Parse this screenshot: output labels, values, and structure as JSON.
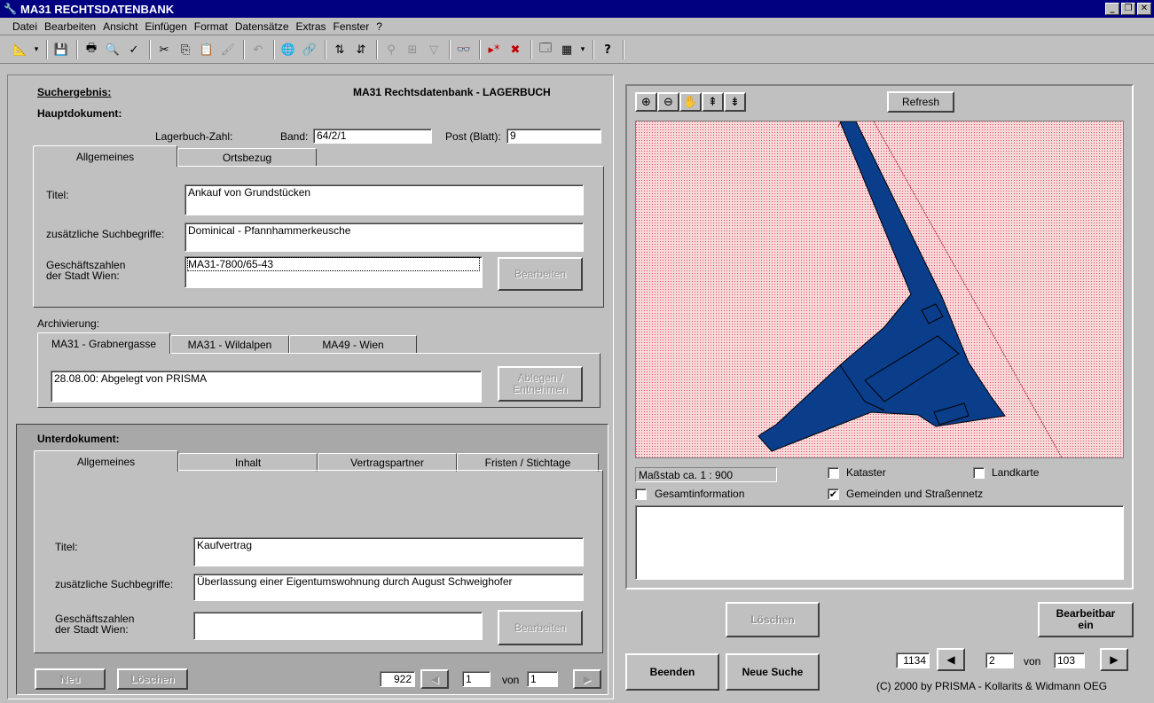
{
  "window": {
    "title": "MA31 RECHTSDATENBANK"
  },
  "menu": [
    "Datei",
    "Bearbeiten",
    "Ansicht",
    "Einfügen",
    "Format",
    "Datensätze",
    "Extras",
    "Fenster",
    "?"
  ],
  "main": {
    "suchergebnis_label": "Suchergebnis:",
    "heading": "MA31 Rechtsdatenbank - LAGERBUCH",
    "hauptdokument_label": "Hauptdokument:",
    "lagerbuch_label": "Lagerbuch-Zahl:",
    "band_label": "Band:",
    "band_value": "64/2/1",
    "post_label": "Post (Blatt):",
    "post_value": "9",
    "tabs": [
      "Allgemeines",
      "Ortsbezug"
    ],
    "titel_label": "Titel:",
    "titel_value": "Ankauf von Grundstücken",
    "suchbegriffe_label": "zusätzliche Suchbegriffe:",
    "suchbegriffe_value": "Dominical - Pfannhammerkeusche",
    "geschaeftszahlen_label_1": "Geschäftszahlen",
    "geschaeftszahlen_label_2": "der Stadt Wien:",
    "geschaeftszahlen_value": "MA31-7800/65-43",
    "bearbeiten_label": "Bearbeiten",
    "archivierung_label": "Archivierung:",
    "archiv_tabs": [
      "MA31 - Grabnergasse",
      "MA31 - Wildalpen",
      "MA49 - Wien"
    ],
    "archiv_value": "28.08.00: Abgelegt von  PRISMA",
    "ablegen_label_1": "Ablegen /",
    "ablegen_label_2": "Entnehmen"
  },
  "sub": {
    "heading": "Unterdokument:",
    "tabs": [
      "Allgemeines",
      "Inhalt",
      "Vertragspartner",
      "Fristen / Stichtage"
    ],
    "titel_label": "Titel:",
    "titel_value": "Kaufvertrag",
    "suchbegriffe_label": "zusätzliche Suchbegriffe:",
    "suchbegriffe_value": "Überlassung einer Eigentumswohnung durch August Schweighofer",
    "geschaeftszahlen_label_1": "Geschäftszahlen",
    "geschaeftszahlen_label_2": "der Stadt Wien:",
    "geschaeftszahlen_value": "",
    "bearbeiten_label": "Bearbeiten",
    "neu_label": "Neu",
    "loeschen_label": "Löschen",
    "record_id": "922",
    "record_current": "1",
    "von_label": "von",
    "record_total": "1"
  },
  "map": {
    "refresh_label": "Refresh",
    "scale_label": "Maßstab ca. 1 : 900",
    "kataster_label": "Kataster",
    "kataster_checked": false,
    "landkarte_label": "Landkarte",
    "landkarte_checked": false,
    "gesamtinfo_label": "Gesamtinformation",
    "gesamtinfo_checked": false,
    "gemeinden_label": "Gemeinden und Straßennetz",
    "gemeinden_checked": true,
    "parcel_color": "#0a3d8a",
    "background_color": "#f3c4c8"
  },
  "footer": {
    "loeschen_label": "Löschen",
    "bearbeitbar_label_1": "Bearbeitbar",
    "bearbeitbar_label_2": "ein",
    "beenden_label": "Beenden",
    "neue_suche_label": "Neue Suche",
    "record_id": "1134",
    "record_current": "2",
    "von_label": "von",
    "record_total": "103",
    "copyright": "(C) 2000 by PRISMA - Kollarits & Widmann OEG"
  }
}
